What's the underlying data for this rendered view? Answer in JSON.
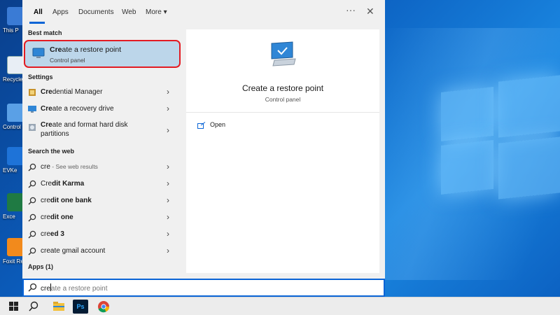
{
  "desktop": {
    "icons": [
      {
        "label": "This P",
        "icon": "computer-icon",
        "color": "#3a7bd5"
      },
      {
        "label": "Recycle",
        "icon": "recycle-bin-icon",
        "color": "#e8eef5"
      },
      {
        "label": "Control P",
        "icon": "control-panel-icon",
        "color": "#5aa0e6"
      },
      {
        "label": "EVKe",
        "icon": "evkey-icon",
        "color": "#1e73d8"
      },
      {
        "label": "Exce",
        "icon": "excel-icon",
        "color": "#1f7a43"
      },
      {
        "label": "Foxit Re",
        "icon": "foxit-reader-icon",
        "color": "#f28a1c"
      }
    ]
  },
  "tabs": {
    "items": [
      "All",
      "Apps",
      "Documents",
      "Web",
      "More"
    ],
    "more_chevron": "▾",
    "more_options": "···",
    "close": "✕"
  },
  "left": {
    "best_match_header": "Best match",
    "best_match": {
      "match": "Cre",
      "rest": "ate a restore point",
      "subtitle": "Control panel"
    },
    "settings_header": "Settings",
    "settings": [
      {
        "match": "Cre",
        "rest": "dential Manager",
        "icon": "credential-manager-icon"
      },
      {
        "match": "Cre",
        "rest": "ate a recovery drive",
        "icon": "recovery-drive-icon"
      },
      {
        "match": "Cre",
        "rest": "ate and format hard disk partitions",
        "icon": "disk-partition-icon"
      }
    ],
    "web_header": "Search the web",
    "web": [
      {
        "text": "cre",
        "suffix": " - See web results",
        "bold": false
      },
      {
        "match": "Cre",
        "rest": "dit Karma",
        "bold": true
      },
      {
        "match": "cre",
        "rest": "dit one bank",
        "bold": true
      },
      {
        "match": "cre",
        "rest": "dit one",
        "bold": true
      },
      {
        "match": "cre",
        "rest": "ed 3",
        "bold": true
      },
      {
        "match": "cre",
        "rest": "ate gmail account",
        "bold": false
      }
    ],
    "apps_header": "Apps (1)",
    "chevron": "›"
  },
  "preview": {
    "title": "Create a restore point",
    "subtitle": "Control panel",
    "open_label": "Open"
  },
  "search": {
    "typed": "cre",
    "suggestion": "ate a restore point"
  },
  "taskbar": {
    "items": [
      "windows-start-icon",
      "search-icon",
      "file-explorer-icon",
      "photoshop-icon",
      "chrome-icon"
    ],
    "photoshop_label": "Ps"
  },
  "colors": {
    "accent": "#0a64d6",
    "highlight": "#bcd6ea",
    "outline": "#e31b23"
  }
}
